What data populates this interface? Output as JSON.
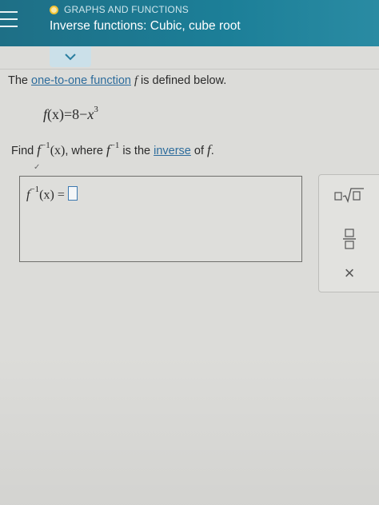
{
  "header": {
    "topic": "GRAPHS AND FUNCTIONS",
    "title": "Inverse functions: Cubic, cube root"
  },
  "statement": {
    "prefix": "The ",
    "link": "one-to-one function",
    "var": "f",
    "suffix": " is defined below."
  },
  "equation": {
    "lhs": "f",
    "arg": "(x)",
    "eq": "=8−",
    "var": "x",
    "exp": "3"
  },
  "prompt": {
    "find": "Find ",
    "f": "f",
    "inv_exp": "−1",
    "arg": "(x)",
    "where": ", where ",
    "f2": "f",
    "inv_exp2": "−1",
    "is_the": " is the ",
    "link": "inverse",
    "of": " of ",
    "f3": "f",
    "period": "."
  },
  "answer": {
    "label_f": "f",
    "label_exp": "−1",
    "label_arg": "(x) ="
  },
  "tools": {
    "clear_symbol": "×"
  },
  "colors": {
    "header": "#1c7f98",
    "link": "#2d6c9c",
    "input_border": "#3c78b0",
    "topic_dot": "#f1c232"
  }
}
